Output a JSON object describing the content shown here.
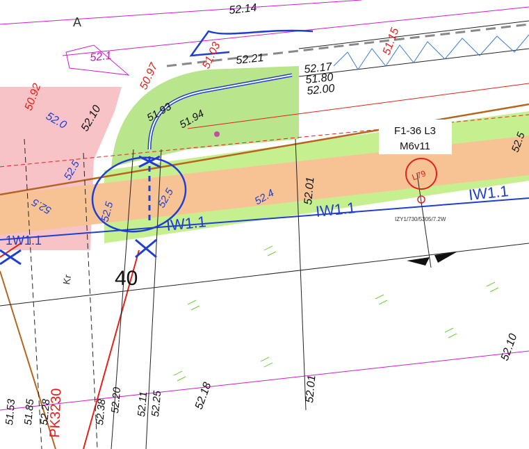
{
  "labels": {
    "sheet_letter": "A",
    "station": "40",
    "cable_box_line1": "F1-36 L3",
    "cable_box_line2": "M6v11",
    "pipe_code": "IZY1/730/5305/7.2W",
    "pipe_label_left": "1W1.1",
    "pipe_label_mid": "IW1.1",
    "pipe_label_right": "IW1.1",
    "pipe_label_far_right": "IW1.1",
    "street_label": "Kr",
    "vertical_red_label": "PK3230",
    "circle_symbol": "L79"
  },
  "elevations": {
    "e1": "52.14",
    "e2": "52.21",
    "e3": "52.17",
    "e4": "51.80",
    "e5": "52.00",
    "e6": "52.1",
    "e7": "52.0",
    "e8": "52.10",
    "e9": "50.97",
    "e10": "51.03",
    "e11": "51.15",
    "e12": "50.92",
    "e13": "51.93",
    "e14": "51.94",
    "e15": "52.5",
    "e16": "52.5",
    "e17": "52.4",
    "e18": "52.5",
    "e19": "52.01",
    "e20": "52.01",
    "e21": "52.10",
    "e22": "52.18",
    "e23": "52.25",
    "e24": "52.11",
    "e25": "52.20",
    "e26": "52.38",
    "e27": "51.53",
    "e28": "51.85",
    "e29": "52.28",
    "e30": "52.5",
    "e31": "52.5"
  },
  "colors": {
    "green_area": "#b9e58c",
    "green_light": "#c6f08f",
    "orange_band": "#f7c394",
    "pink_area": "#f7c3c6",
    "brown_line": "#b5651d",
    "blue_pipe": "#1f3fcf",
    "red_line": "#e3201b",
    "magenta_line": "#d01ccf",
    "survey_green": "#6dd13f"
  }
}
